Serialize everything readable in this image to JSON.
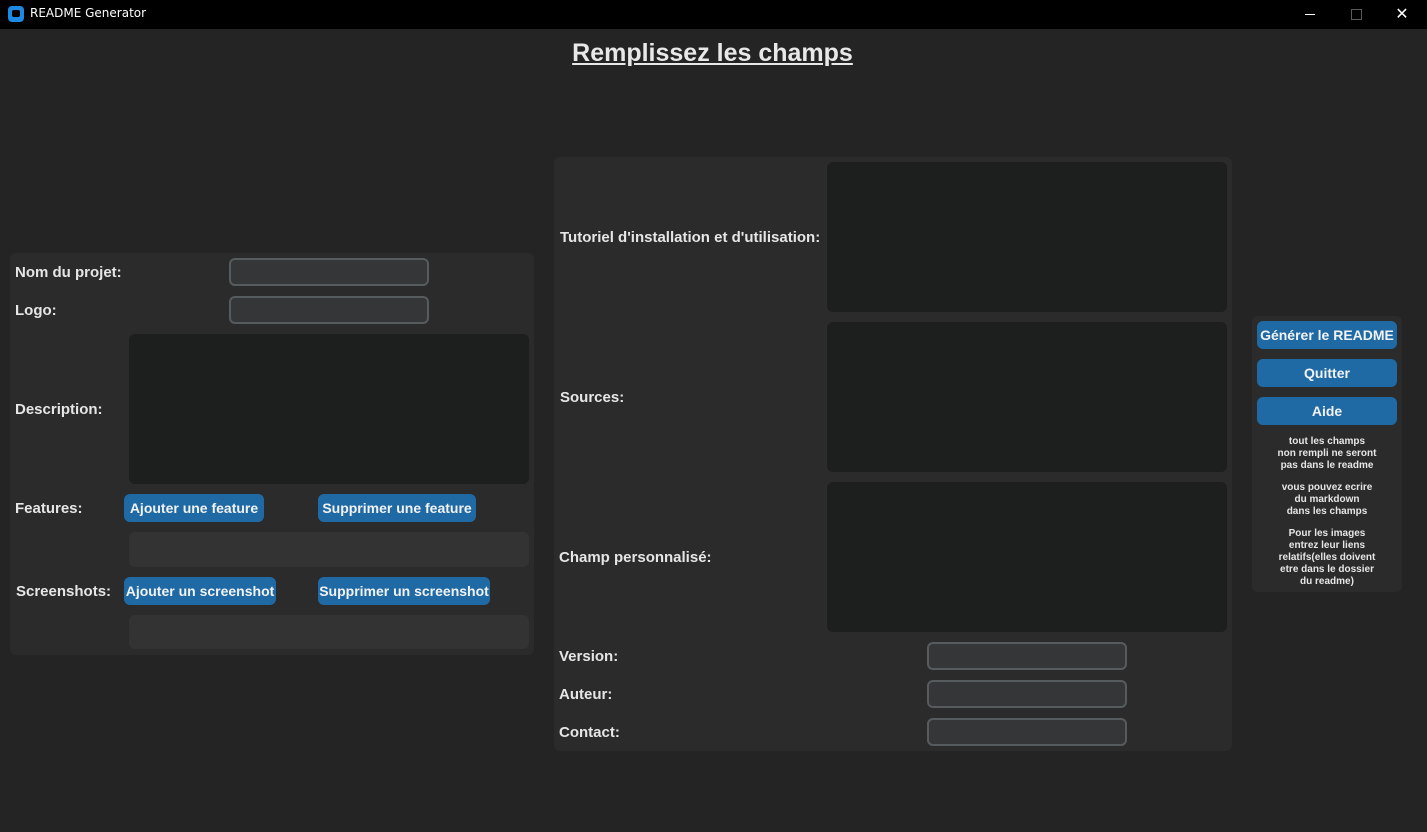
{
  "window": {
    "title": "README Generator"
  },
  "header": {
    "title": "Remplissez les champs"
  },
  "left_panel": {
    "project_name_label": "Nom du projet:",
    "project_name_value": "",
    "logo_label": "Logo:",
    "logo_value": "",
    "description_label": "Description:",
    "features_label": "Features:",
    "add_feature_label": "Ajouter une feature",
    "remove_feature_label": "Supprimer une feature",
    "screenshots_label": "Screenshots:",
    "add_screenshot_label": "Ajouter un screenshot",
    "remove_screenshot_label": "Supprimer un screenshot"
  },
  "center_panel": {
    "tutorial_label": "Tutoriel d'installation et d'utilisation:",
    "sources_label": "Sources:",
    "custom_field_label": "Champ personnalisé:",
    "version_label": "Version:",
    "version_value": "",
    "author_label": "Auteur:",
    "author_value": "",
    "contact_label": "Contact:",
    "contact_value": ""
  },
  "right_panel": {
    "generate_label": "Générer le README",
    "quit_label": "Quitter",
    "help_label": "Aide",
    "note_empty_fields": "tout les champs\nnon rempli ne seront\npas dans le readme",
    "note_markdown": "vous pouvez ecrire\ndu markdown\ndans les champs",
    "note_images": "Pour les images\nentrez leur liens\nrelatifs(elles doivent\netre dans le dossier\ndu readme)"
  },
  "colors": {
    "background": "#242424",
    "frame": "#2b2b2b",
    "accent_button": "#1f6aa5",
    "entry_bg": "#343638",
    "entry_border": "#565b5e",
    "textbox_bg": "#1d1e1e",
    "titlebar": "#000000"
  },
  "icons": {
    "app": "app-icon",
    "minimize": "minimize-icon",
    "maximize": "maximize-icon",
    "close": "close-icon"
  }
}
